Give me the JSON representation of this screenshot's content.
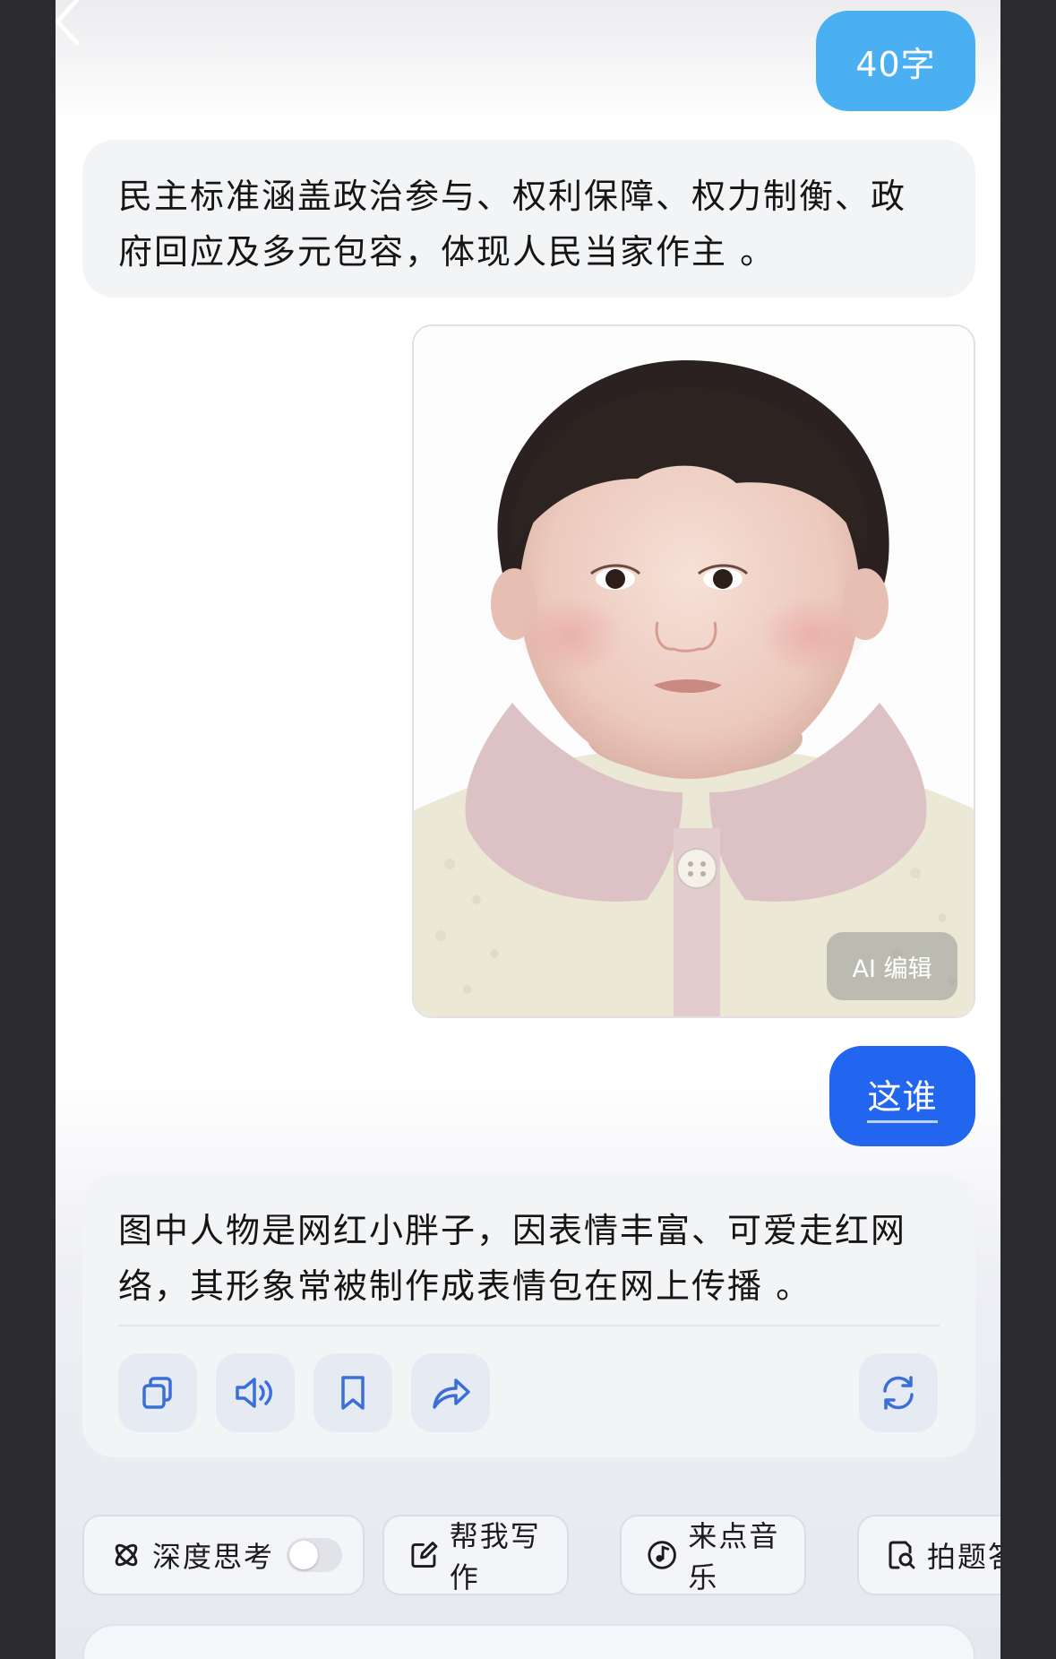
{
  "messages": {
    "user_1": "40字",
    "ai_1": "民主标准涵盖政治参与、权利保障、权力制衡、政府回应及多元包容，体现人民当家作主 。",
    "image_overlay_button": "AI 编辑",
    "user_2": "这谁",
    "ai_2": "图中人物是网红小胖子，因表情丰富、可爱走红网络，其形象常被制作成表情包在网上传播 。"
  },
  "actions": [
    "copy-icon",
    "speaker-icon",
    "bookmark-icon",
    "share-icon",
    "regenerate-icon"
  ],
  "chips": {
    "deep_think": "深度思考",
    "deep_think_enabled": false,
    "write": "帮我写作",
    "music": "来点音乐",
    "photo_answer": "拍题答"
  },
  "colors": {
    "user_bubble_light": "#4bb0f2",
    "user_bubble_blue": "#2266f0",
    "ai_bubble": "#f3f4f6",
    "icon_blue": "#3a6fd8"
  }
}
